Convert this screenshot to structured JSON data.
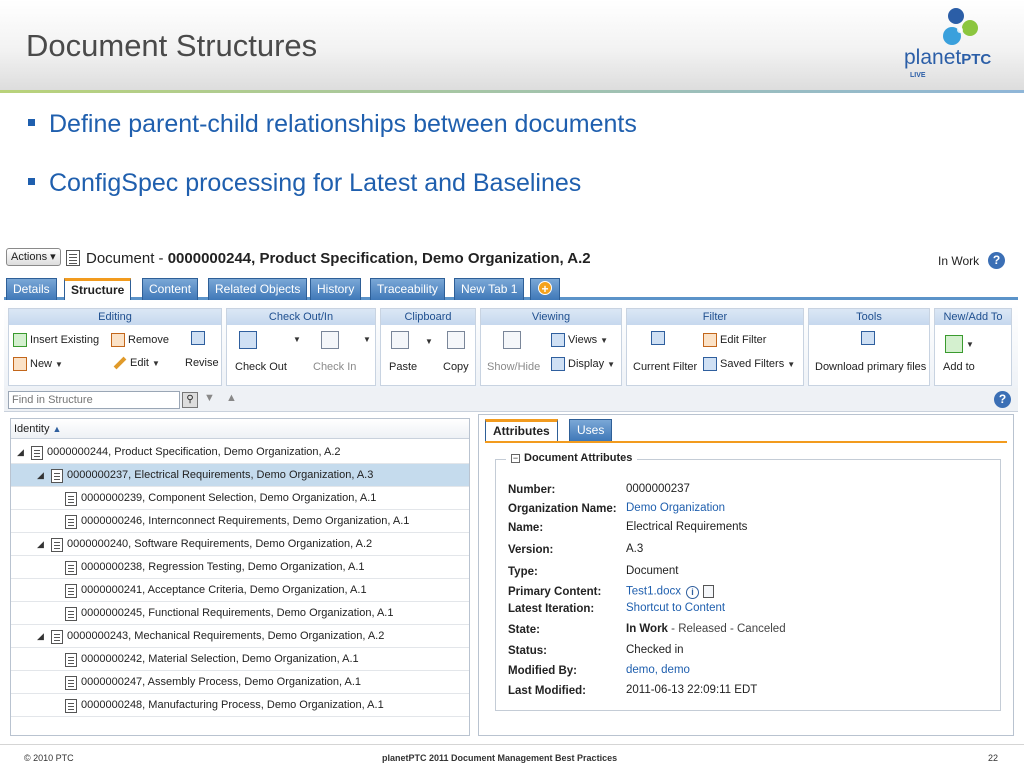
{
  "slide": {
    "title": "Document Structures",
    "logo_text": "planet",
    "logo_ptc": "PTC",
    "logo_live": "LIVE",
    "bullets": [
      "Define parent-child relationships between documents",
      "ConfigSpec processing for Latest and Baselines"
    ],
    "footer_left": "© 2010 PTC",
    "footer_center": "planetPTC 2011 Document Management Best Practices",
    "page_number": "22"
  },
  "app": {
    "actions_label": "Actions ▾",
    "doc_title_prefix": "Document - ",
    "doc_title_bold": "0000000244, Product Specification, Demo Organization, A.2",
    "state": "In Work",
    "help": "?",
    "tabs": [
      "Details",
      "Structure",
      "Content",
      "Related Objects",
      "History",
      "Traceability",
      "New Tab 1"
    ],
    "active_tab": "Structure",
    "ribbon": {
      "editing": {
        "header": "Editing",
        "insert_existing": "Insert Existing",
        "remove": "Remove",
        "new": "New",
        "edit": "Edit",
        "revise": "Revise"
      },
      "checkout": {
        "header": "Check Out/In",
        "check_out": "Check Out",
        "check_in": "Check In"
      },
      "clipboard": {
        "header": "Clipboard",
        "paste": "Paste",
        "copy": "Copy"
      },
      "viewing": {
        "header": "Viewing",
        "show_hide": "Show/Hide",
        "views": "Views",
        "display": "Display"
      },
      "filter": {
        "header": "Filter",
        "edit_filter": "Edit Filter",
        "current_filter": "Current Filter",
        "saved_filters": "Saved Filters"
      },
      "tools": {
        "header": "Tools",
        "download": "Download primary files"
      },
      "new_add": {
        "header": "New/Add To",
        "add_to": "Add to"
      }
    },
    "find_placeholder": "Find in Structure",
    "tree": {
      "column_header": "Identity",
      "rows": [
        {
          "level": 0,
          "toggle": "◢",
          "text": "0000000244, Product Specification, Demo Organization, A.2",
          "selected": false
        },
        {
          "level": 1,
          "toggle": "◢",
          "text": "0000000237, Electrical Requirements, Demo Organization, A.3",
          "selected": true
        },
        {
          "level": 2,
          "toggle": "",
          "text": "0000000239, Component Selection, Demo Organization, A.1",
          "selected": false
        },
        {
          "level": 2,
          "toggle": "",
          "text": "0000000246, Internconnect Requirements, Demo Organization, A.1",
          "selected": false
        },
        {
          "level": 1,
          "toggle": "◢",
          "text": "0000000240, Software Requirements, Demo Organization, A.2",
          "selected": false
        },
        {
          "level": 2,
          "toggle": "",
          "text": "0000000238, Regression Testing, Demo Organization, A.1",
          "selected": false
        },
        {
          "level": 2,
          "toggle": "",
          "text": "0000000241, Acceptance Criteria, Demo Organization, A.1",
          "selected": false
        },
        {
          "level": 2,
          "toggle": "",
          "text": "0000000245, Functional Requirements, Demo Organization, A.1",
          "selected": false
        },
        {
          "level": 1,
          "toggle": "◢",
          "text": "0000000243, Mechanical Requirements, Demo Organization, A.2",
          "selected": false
        },
        {
          "level": 2,
          "toggle": "",
          "text": "0000000242, Material Selection, Demo Organization, A.1",
          "selected": false
        },
        {
          "level": 2,
          "toggle": "",
          "text": "0000000247, Assembly Process, Demo Organization, A.1",
          "selected": false
        },
        {
          "level": 2,
          "toggle": "",
          "text": "0000000248, Manufacturing Process, Demo Organization, A.1",
          "selected": false
        }
      ]
    },
    "panel": {
      "tabs": [
        "Attributes",
        "Uses"
      ],
      "active_tab": "Attributes",
      "section_title": "Document Attributes",
      "attributes": [
        {
          "label": "Number:",
          "value": "0000000237",
          "link": false
        },
        {
          "label": "Organization Name:",
          "value": "Demo Organization",
          "link": true
        },
        {
          "label": "Name:",
          "value": "Electrical Requirements",
          "link": false
        },
        {
          "label": "Version:",
          "value": "A.3",
          "link": false
        },
        {
          "label": "Type:",
          "value": "Document",
          "link": false
        },
        {
          "label": "Primary Content:",
          "value": "Test1.docx",
          "link": true
        },
        {
          "label": "Latest Iteration:",
          "value": "Shortcut to Content",
          "link": true
        },
        {
          "label": "State:",
          "value_bold": "In Work",
          "value": " - Released - Canceled",
          "link": false
        },
        {
          "label": "Status:",
          "value": "Checked in",
          "link": false
        },
        {
          "label": "Modified By:",
          "value": "demo, demo",
          "link": true
        },
        {
          "label": "Last Modified:",
          "value": "2011-06-13 22:09:11 EDT",
          "link": false
        }
      ]
    }
  }
}
